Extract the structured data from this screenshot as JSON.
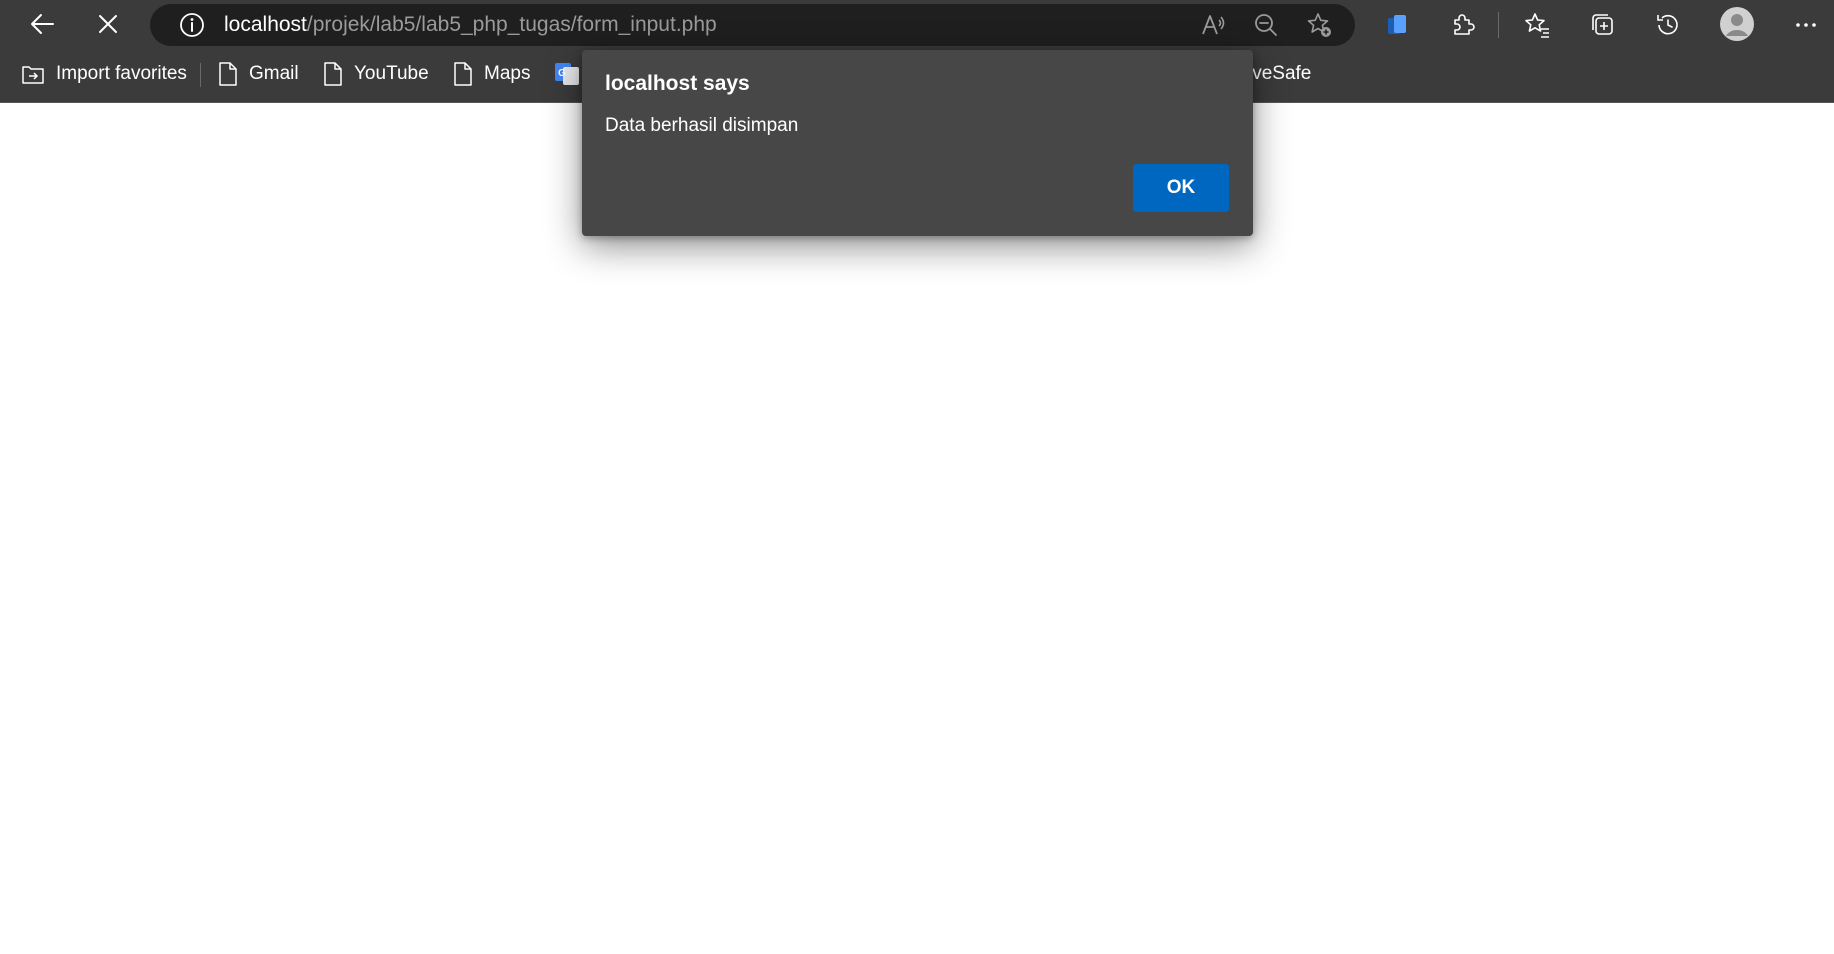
{
  "browser": {
    "url": {
      "host": "localhost",
      "path": "/projek/lab5/lab5_php_tugas/form_input.php"
    },
    "nav_icons": [
      "back-arrow-icon",
      "stop-loading-icon",
      "site-info-icon"
    ],
    "address_icons": [
      "read-aloud-icon",
      "zoom-out-icon",
      "add-favorite-icon"
    ],
    "toolbar_icons": [
      "office-icon",
      "extensions-icon",
      "favorites-icon",
      "collections-icon",
      "history-icon",
      "profile-avatar-icon",
      "more-menu-icon"
    ],
    "bookmarks": [
      {
        "label": "Import favorites",
        "icon": "import-favorites-icon"
      },
      {
        "label": "Gmail",
        "icon": "page-icon"
      },
      {
        "label": "YouTube",
        "icon": "page-icon"
      },
      {
        "label": "Maps",
        "icon": "page-icon"
      },
      {
        "label": "",
        "icon": "google-translate-icon"
      },
      {
        "label": "iveSafe",
        "icon": ""
      }
    ]
  },
  "dialog": {
    "title": "localhost says",
    "message": "Data berhasil disimpan",
    "ok_label": "OK",
    "accent_color": "#0067c0"
  }
}
